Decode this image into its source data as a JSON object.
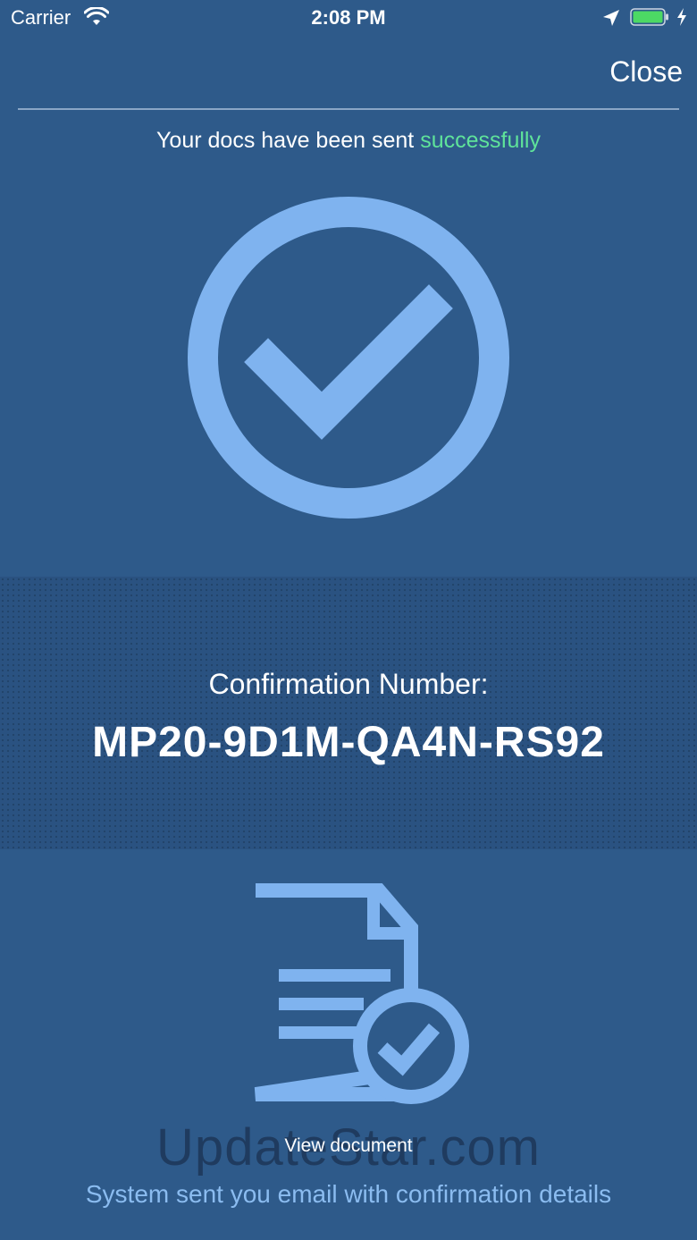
{
  "status_bar": {
    "carrier": "Carrier",
    "time": "2:08 PM"
  },
  "header": {
    "close_label": "Close"
  },
  "main": {
    "headline_prefix": "Your docs have been sent ",
    "headline_status": "successfully",
    "confirmation_label": "Confirmation Number:",
    "confirmation_number": "MP20-9D1M-QA4N-RS92",
    "view_document_label": "View document",
    "email_note": "System sent you email with confirmation details"
  },
  "watermark": "UpdateStar.com",
  "colors": {
    "background": "#2e5a8a",
    "accent_icon": "#7fb3ef",
    "success_text": "#5fe39a",
    "note_text": "#8bbcf0",
    "battery_fill": "#4cd964"
  },
  "icons": [
    "wifi-icon",
    "location-arrow-icon",
    "battery-icon",
    "charging-bolt-icon",
    "check-circle-icon",
    "document-check-icon"
  ]
}
